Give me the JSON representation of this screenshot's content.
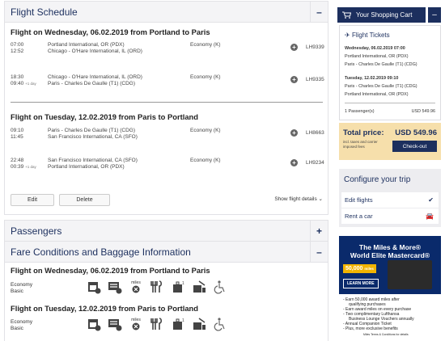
{
  "flight_schedule": {
    "title": "Flight Schedule",
    "toggle": "–",
    "outbound": {
      "title": "Flight on Wednesday, 06.02.2019 from Portland to Paris",
      "segments": [
        {
          "dep": "07:00",
          "arr": "12:52",
          "arr_sup": "",
          "from": "Portland International, OR (PDX)",
          "to": "Chicago - O'Hare International, IL (ORD)",
          "cabin": "Economy (K)",
          "flight": "LH9339"
        },
        {
          "dep": "18:30",
          "arr": "09:40",
          "arr_sup": "+1 day",
          "from": "Chicago - O'Hare International, IL (ORD)",
          "to": "Paris - Charles De Gaulle (T1) (CDG)",
          "cabin": "Economy (K)",
          "flight": "LH9335"
        }
      ]
    },
    "inbound": {
      "title": "Flight on Tuesday, 12.02.2019 from Paris to Portland",
      "segments": [
        {
          "dep": "09:10",
          "arr": "11:45",
          "arr_sup": "",
          "from": "Paris - Charles De Gaulle (T1) (CDG)",
          "to": "San Francisco International, CA (SFO)",
          "cabin": "Economy (K)",
          "flight": "LH8663"
        },
        {
          "dep": "22:48",
          "arr": "00:39",
          "arr_sup": "+1 day",
          "from": "San Francisco International, CA (SFO)",
          "to": "Portland International, OR (PDX)",
          "cabin": "Economy (K)",
          "flight": "LH9234"
        }
      ]
    },
    "edit_label": "Edit",
    "delete_label": "Delete",
    "details_label": "Show flight details ⌄"
  },
  "passengers": {
    "title": "Passengers",
    "toggle": "+"
  },
  "fare": {
    "title": "Fare Conditions and Baggage Information",
    "toggle": "–",
    "outbound_title": "Flight on Wednesday, 06.02.2019 from Portland to Paris",
    "inbound_title": "Flight on Tuesday, 12.02.2019 from Paris to Portland",
    "fare_class": "Economy",
    "fare_type": "Basic",
    "miles_label": "miles",
    "icons": [
      "seat-reservation-icon",
      "rebooking-icon",
      "miles-icon",
      "meal-icon",
      "carry-on-baggage-icon",
      "checked-baggage-icon",
      "accessibility-icon"
    ]
  },
  "cart": {
    "title": "Your Shopping Cart",
    "toggle": "–"
  },
  "tickets": {
    "title": "Flight Tickets",
    "outbound_date": "Wednesday, 06.02.2019 07:00",
    "outbound_from": "Portland International, OR (PDX)",
    "outbound_to": "Paris - Charles De Gaulle (T1) (CDG)",
    "inbound_date": "Tuesday, 12.02.2019 09:10",
    "inbound_from": "Paris - Charles De Gaulle (T1) (CDG)",
    "inbound_to": "Portland International, OR (PDX)",
    "passengers": "1 Passenger(s)",
    "price": "USD 549.96"
  },
  "total": {
    "label": "Total price:",
    "amount": "USD 549.96",
    "note": "incl. taxes and carrier imposed fees",
    "checkout": "Check-out"
  },
  "configure": {
    "title": "Configure your trip",
    "edit_flights": "Edit flights",
    "rent_car": "Rent a car"
  },
  "ad": {
    "headline1": "The Miles & More®",
    "headline2": "World Elite Mastercard®",
    "bonus": "50,000",
    "bonus_unit": "miles",
    "learn_more": "LEARN MORE",
    "bullets": [
      "- Earn 50,000 award miles after",
      "qualifying purchases",
      "- Earn award miles on every purchase",
      "- Two complimentary Lufthansa",
      "Business Lounge Vouchers annually",
      "- Annual Companion Ticket",
      "- Plus, more exclusive benefits"
    ],
    "footer": "Miles Terms & Conditions for details"
  },
  "colors": {
    "brand": "#1c2f5e",
    "total_bg": "#f6dfab",
    "ad_bg": "#0a2a6b"
  }
}
